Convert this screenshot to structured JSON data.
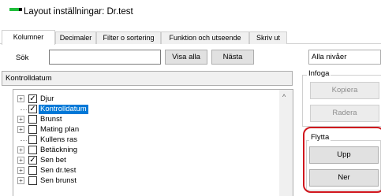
{
  "window": {
    "title": "Layout inställningar: Dr.test"
  },
  "tabs": [
    {
      "label": "Kolumner",
      "active": true
    },
    {
      "label": "Decimaler",
      "active": false
    },
    {
      "label": "Filter o sortering",
      "active": false
    },
    {
      "label": "Funktion och utseende",
      "active": false
    },
    {
      "label": "Skriv ut",
      "active": false
    }
  ],
  "search": {
    "label": "Sök",
    "value": "",
    "show_all_label": "Visa alla",
    "next_label": "Nästa",
    "level_selected": "Alla nivåer"
  },
  "list_header": "Kontrolldatum",
  "tree_items": [
    {
      "label": "Djur",
      "checked": true,
      "expandable": true,
      "selected": false
    },
    {
      "label": "Kontrolldatum",
      "checked": true,
      "expandable": false,
      "selected": true
    },
    {
      "label": "Brunst",
      "checked": false,
      "expandable": true,
      "selected": false
    },
    {
      "label": "Mating plan",
      "checked": false,
      "expandable": true,
      "selected": false
    },
    {
      "label": "Kullens ras",
      "checked": false,
      "expandable": false,
      "selected": false
    },
    {
      "label": "Betäckning",
      "checked": false,
      "expandable": true,
      "selected": false
    },
    {
      "label": "Sen bet",
      "checked": true,
      "expandable": true,
      "selected": false
    },
    {
      "label": "Sen dr.test",
      "checked": false,
      "expandable": true,
      "selected": false
    },
    {
      "label": "Sen brunst",
      "checked": false,
      "expandable": true,
      "selected": false
    }
  ],
  "infoga": {
    "title": "Infoga",
    "copy_label": "Kopiera",
    "delete_label": "Radera"
  },
  "flytta": {
    "title": "Flytta",
    "up_label": "Upp",
    "down_label": "Ner"
  },
  "colors": {
    "selection": "#0078d7",
    "highlight_ring": "#d0161d",
    "app_icon": "#1fbe3a"
  }
}
